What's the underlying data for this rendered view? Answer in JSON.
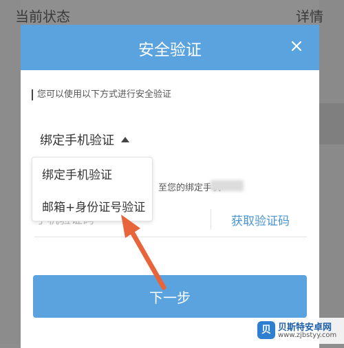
{
  "background": {
    "left_text": "当前状态",
    "right_text": "详情"
  },
  "dialog": {
    "title": "安全验证",
    "close_icon": "close-icon",
    "hint": "您可以使用以下方式进行安全验证",
    "selected_method": "绑定手机验证",
    "caret_icon": "caret-up-icon",
    "description": "至您的绑定手机",
    "code_placeholder": "手机验证码",
    "get_code_label": "获取验证码",
    "next_label": "下一步"
  },
  "dropdown": {
    "options": [
      "绑定手机验证",
      "邮箱+身份证号验证"
    ]
  },
  "annotation": {
    "arrow_color": "#e8643b"
  },
  "watermark": {
    "logo": "贝",
    "title": "贝斯特安卓网",
    "url": "www.zjbstyy.com"
  },
  "colors": {
    "accent": "#5aa3de",
    "link": "#4a94d2"
  }
}
